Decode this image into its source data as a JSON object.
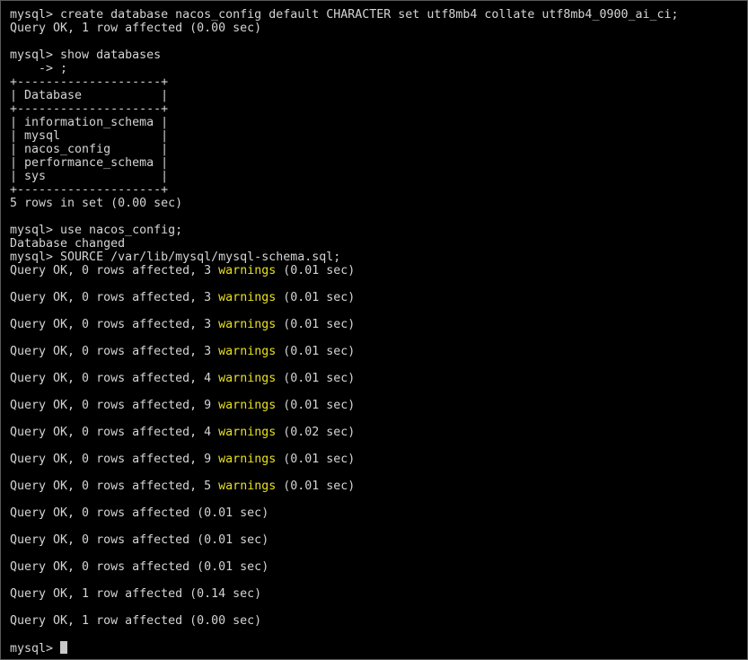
{
  "terminal": {
    "colors": {
      "background": "#000000",
      "text": "#d4d4d4",
      "warning": "#e8e022",
      "cursor": "#c8c8c8"
    },
    "lines": [
      {
        "text": "mysql> create database nacos_config default CHARACTER set utf8mb4 collate utf8mb4_0900_ai_ci;"
      },
      {
        "text": "Query OK, 1 row affected (0.00 sec)"
      },
      {
        "text": ""
      },
      {
        "text": "mysql> show databases"
      },
      {
        "text": "    -> ;"
      },
      {
        "text": "+--------------------+"
      },
      {
        "text": "| Database           |"
      },
      {
        "text": "+--------------------+"
      },
      {
        "text": "| information_schema |"
      },
      {
        "text": "| mysql              |"
      },
      {
        "text": "| nacos_config       |"
      },
      {
        "text": "| performance_schema |"
      },
      {
        "text": "| sys                |"
      },
      {
        "text": "+--------------------+"
      },
      {
        "text": "5 rows in set (0.00 sec)"
      },
      {
        "text": ""
      },
      {
        "text": "mysql> use nacos_config;"
      },
      {
        "text": "Database changed"
      },
      {
        "text": "mysql> SOURCE /var/lib/mysql/mysql-schema.sql;"
      },
      {
        "pre": "Query OK, 0 rows affected, 3 ",
        "warn": "warnings",
        "post": " (0.01 sec)"
      },
      {
        "text": ""
      },
      {
        "pre": "Query OK, 0 rows affected, 3 ",
        "warn": "warnings",
        "post": " (0.01 sec)"
      },
      {
        "text": ""
      },
      {
        "pre": "Query OK, 0 rows affected, 3 ",
        "warn": "warnings",
        "post": " (0.01 sec)"
      },
      {
        "text": ""
      },
      {
        "pre": "Query OK, 0 rows affected, 3 ",
        "warn": "warnings",
        "post": " (0.01 sec)"
      },
      {
        "text": ""
      },
      {
        "pre": "Query OK, 0 rows affected, 4 ",
        "warn": "warnings",
        "post": " (0.01 sec)"
      },
      {
        "text": ""
      },
      {
        "pre": "Query OK, 0 rows affected, 9 ",
        "warn": "warnings",
        "post": " (0.01 sec)"
      },
      {
        "text": ""
      },
      {
        "pre": "Query OK, 0 rows affected, 4 ",
        "warn": "warnings",
        "post": " (0.02 sec)"
      },
      {
        "text": ""
      },
      {
        "pre": "Query OK, 0 rows affected, 9 ",
        "warn": "warnings",
        "post": " (0.01 sec)"
      },
      {
        "text": ""
      },
      {
        "pre": "Query OK, 0 rows affected, 5 ",
        "warn": "warnings",
        "post": " (0.01 sec)"
      },
      {
        "text": ""
      },
      {
        "text": "Query OK, 0 rows affected (0.01 sec)"
      },
      {
        "text": ""
      },
      {
        "text": "Query OK, 0 rows affected (0.01 sec)"
      },
      {
        "text": ""
      },
      {
        "text": "Query OK, 0 rows affected (0.01 sec)"
      },
      {
        "text": ""
      },
      {
        "text": "Query OK, 1 row affected (0.14 sec)"
      },
      {
        "text": ""
      },
      {
        "text": "Query OK, 1 row affected (0.00 sec)"
      },
      {
        "text": ""
      }
    ],
    "prompt": "mysql> "
  }
}
